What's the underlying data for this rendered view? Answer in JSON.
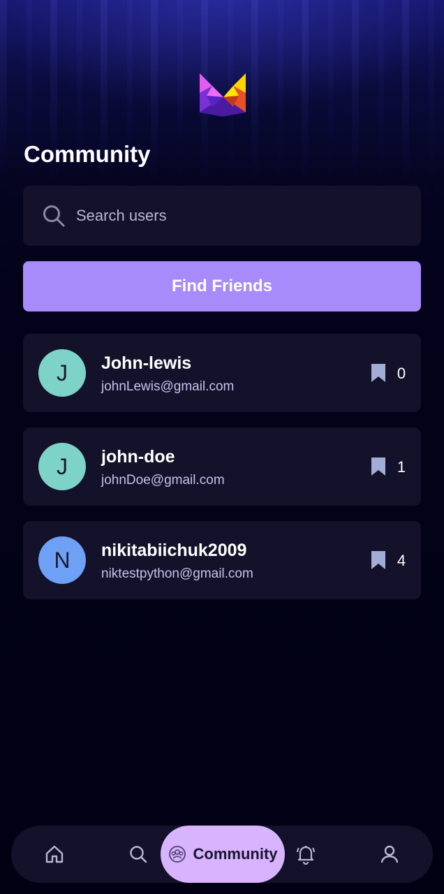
{
  "page": {
    "title": "Community"
  },
  "search": {
    "placeholder": "Search users",
    "value": ""
  },
  "find_friends": {
    "label": "Find Friends"
  },
  "users": [
    {
      "initial": "J",
      "name": "John-lewis",
      "email": "johnLewis@gmail.com",
      "bookmarks": "0",
      "avatar_color": "#7dd3c8"
    },
    {
      "initial": "J",
      "name": "john-doe",
      "email": "johnDoe@gmail.com",
      "bookmarks": "1",
      "avatar_color": "#7dd3c8"
    },
    {
      "initial": "N",
      "name": "nikitabiichuk2009",
      "email": "niktestpython@gmail.com",
      "bookmarks": "4",
      "avatar_color": "#6ea0f5"
    }
  ],
  "nav": {
    "items": [
      {
        "icon": "home-icon"
      },
      {
        "icon": "search-icon"
      },
      {
        "icon": "community-icon",
        "label": "Community",
        "active": true
      },
      {
        "icon": "bell-icon"
      },
      {
        "icon": "user-icon"
      }
    ]
  },
  "colors": {
    "accent": "#a78bfa",
    "active_nav": "#d8b4fe",
    "card": "#13122a",
    "background": "#03021a"
  }
}
